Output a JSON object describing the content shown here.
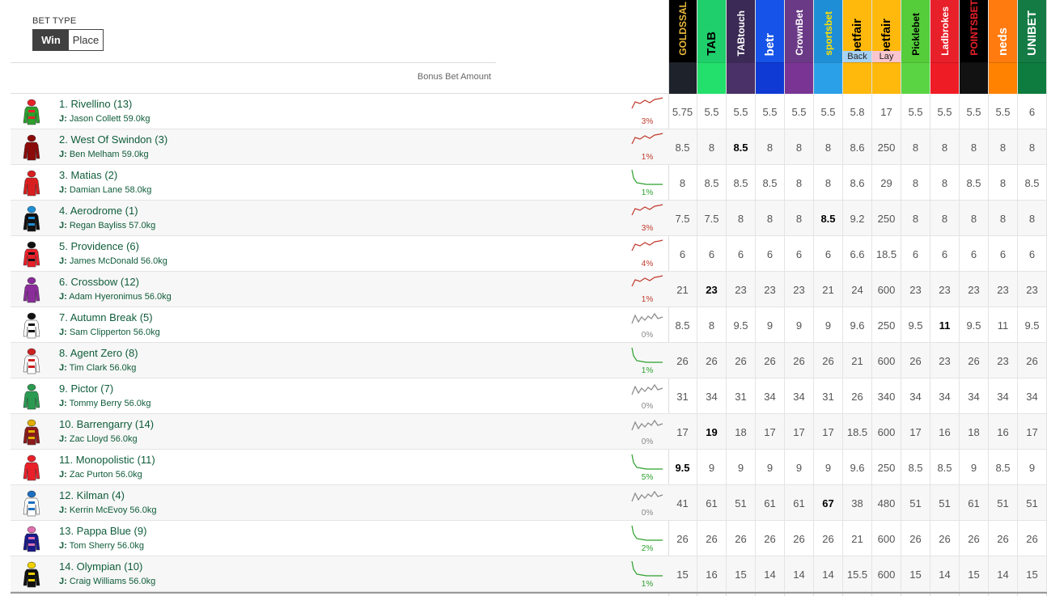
{
  "bet_type": {
    "label": "BET TYPE",
    "win": "Win",
    "place": "Place",
    "selected": "Win"
  },
  "bonus_label": "Bonus Bet Amount",
  "bookmakers": [
    {
      "name": "GOLDSSAL",
      "bg": "#000000",
      "strip": "#1e232b",
      "fg": "#e7b83a"
    },
    {
      "name": "TAB",
      "bg": "#1fcf6b",
      "strip": "#22e06b",
      "fg": "#000000"
    },
    {
      "name": "TABtouch",
      "bg": "#3b2a55",
      "strip": "#4a3167",
      "fg": "#ffffff"
    },
    {
      "name": "betr",
      "bg": "#1653e8",
      "strip": "#0f3bd4",
      "fg": "#ffffff"
    },
    {
      "name": "CrownBet",
      "bg": "#6b3a86",
      "strip": "#7a3594",
      "fg": "#ffffff"
    },
    {
      "name": "sportsbet",
      "bg": "#1e8fd6",
      "strip": "#2aa0e8",
      "fg": "#ffe000"
    },
    {
      "name": "betfair",
      "bg": "#ffb80c",
      "strip": "#ffb80c",
      "fg": "#000000",
      "tag": "Back",
      "tag_bg": "#a6d2f5"
    },
    {
      "name": "betfair",
      "bg": "#ffb80c",
      "strip": "#ffb80c",
      "fg": "#000000",
      "tag": "Lay",
      "tag_bg": "#f9c5cf"
    },
    {
      "name": "Picklebet",
      "bg": "#55cc3a",
      "strip": "#5ad442",
      "fg": "#000000"
    },
    {
      "name": "Ladbrokes",
      "bg": "#e8202a",
      "strip": "#ee1c25",
      "fg": "#ffffff"
    },
    {
      "name": "POINTSBET",
      "bg": "#000000",
      "strip": "#121212",
      "fg": "#e8202a"
    },
    {
      "name": "neds",
      "bg": "#ff7a0f",
      "strip": "#ff8200",
      "fg": "#ffffff"
    },
    {
      "name": "UNIBET",
      "bg": "#147b45",
      "strip": "#0d7c3e",
      "fg": "#ffffff"
    }
  ],
  "runners": [
    {
      "name": "1. Rivellino (13)",
      "jockey": "Jason Collett 59.0kg",
      "silk": [
        "#2ca02c",
        "#e8202a"
      ],
      "trend": "up",
      "pct": "3%",
      "odds": [
        "5.75",
        "5.5",
        "5.5",
        "5.5",
        "5.5",
        "5.5",
        "5.8",
        "17",
        "5.5",
        "5.5",
        "5.5",
        "5.5",
        "6"
      ],
      "best": []
    },
    {
      "name": "2. West Of Swindon (3)",
      "jockey": "Ben Melham 59.0kg",
      "silk": [
        "#8b0a0a",
        "#8b0a0a"
      ],
      "trend": "up",
      "pct": "1%",
      "odds": [
        "8.5",
        "8",
        "8.5",
        "8",
        "8",
        "8",
        "8.6",
        "250",
        "8",
        "8",
        "8",
        "8",
        "8"
      ],
      "best": [
        2
      ]
    },
    {
      "name": "3. Matias (2)",
      "jockey": "Damian Lane 58.0kg",
      "silk": [
        "#d81f1f",
        "#d81f1f"
      ],
      "trend": "down",
      "pct": "1%",
      "odds": [
        "8",
        "8.5",
        "8.5",
        "8.5",
        "8",
        "8",
        "8.6",
        "29",
        "8",
        "8",
        "8.5",
        "8",
        "8.5"
      ],
      "best": []
    },
    {
      "name": "4. Aerodrome (1)",
      "jockey": "Regan Bayliss 57.0kg",
      "silk": [
        "#111111",
        "#1e8fd6"
      ],
      "trend": "up",
      "pct": "3%",
      "odds": [
        "7.5",
        "7.5",
        "8",
        "8",
        "8",
        "8.5",
        "9.2",
        "250",
        "8",
        "8",
        "8",
        "8",
        "8"
      ],
      "best": [
        5
      ]
    },
    {
      "name": "5. Providence (6)",
      "jockey": "James McDonald 56.0kg",
      "silk": [
        "#e8202a",
        "#111111"
      ],
      "trend": "up",
      "pct": "4%",
      "odds": [
        "6",
        "6",
        "6",
        "6",
        "6",
        "6",
        "6.6",
        "18.5",
        "6",
        "6",
        "6",
        "6",
        "6"
      ],
      "best": []
    },
    {
      "name": "6. Crossbow (12)",
      "jockey": "Adam Hyeronimus 56.0kg",
      "silk": [
        "#8a2d9a",
        "#8a2d9a"
      ],
      "trend": "up",
      "pct": "1%",
      "odds": [
        "21",
        "23",
        "23",
        "23",
        "23",
        "21",
        "24",
        "600",
        "23",
        "23",
        "23",
        "23",
        "23"
      ],
      "best": [
        1
      ]
    },
    {
      "name": "7. Autumn Break (5)",
      "jockey": "Sam Clipperton 56.0kg",
      "silk": [
        "#ffffff",
        "#111111"
      ],
      "trend": "flat",
      "pct": "0%",
      "odds": [
        "8.5",
        "8",
        "9.5",
        "9",
        "9",
        "9",
        "9.6",
        "250",
        "9.5",
        "11",
        "9.5",
        "11",
        "9.5"
      ],
      "best": [
        9
      ]
    },
    {
      "name": "8. Agent Zero (8)",
      "jockey": "Tim Clark 56.0kg",
      "silk": [
        "#ffffff",
        "#cc2222"
      ],
      "trend": "down",
      "pct": "1%",
      "odds": [
        "26",
        "26",
        "26",
        "26",
        "26",
        "26",
        "21",
        "600",
        "26",
        "23",
        "26",
        "23",
        "26"
      ],
      "best": []
    },
    {
      "name": "9. Pictor (7)",
      "jockey": "Tommy Berry 56.0kg",
      "silk": [
        "#2a9a50",
        "#2a9a50"
      ],
      "trend": "flat",
      "pct": "0%",
      "odds": [
        "31",
        "34",
        "31",
        "34",
        "34",
        "31",
        "26",
        "340",
        "34",
        "34",
        "34",
        "34",
        "34"
      ],
      "best": []
    },
    {
      "name": "10. Barrengarry (14)",
      "jockey": "Zac Lloyd 56.0kg",
      "silk": [
        "#8b1a1a",
        "#e0b000"
      ],
      "trend": "flat",
      "pct": "0%",
      "odds": [
        "17",
        "19",
        "18",
        "17",
        "17",
        "17",
        "18.5",
        "600",
        "17",
        "16",
        "18",
        "16",
        "17"
      ],
      "best": [
        1
      ]
    },
    {
      "name": "11. Monopolistic (11)",
      "jockey": "Zac Purton 56.0kg",
      "silk": [
        "#e8202a",
        "#e8202a"
      ],
      "trend": "down",
      "pct": "5%",
      "odds": [
        "9.5",
        "9",
        "9",
        "9",
        "9",
        "9",
        "9.6",
        "250",
        "8.5",
        "8.5",
        "9",
        "8.5",
        "9"
      ],
      "best": [
        0
      ]
    },
    {
      "name": "12. Kilman (4)",
      "jockey": "Kerrin McEvoy 56.0kg",
      "silk": [
        "#ffffff",
        "#1e6fc0"
      ],
      "trend": "flat",
      "pct": "0%",
      "odds": [
        "41",
        "61",
        "51",
        "61",
        "61",
        "67",
        "38",
        "480",
        "51",
        "51",
        "61",
        "51",
        "51"
      ],
      "best": [
        5
      ]
    },
    {
      "name": "13. Pappa Blue (9)",
      "jockey": "Tom Sherry 56.0kg",
      "silk": [
        "#1a1a8a",
        "#e070b0"
      ],
      "trend": "down",
      "pct": "2%",
      "odds": [
        "26",
        "26",
        "26",
        "26",
        "26",
        "26",
        "21",
        "600",
        "26",
        "26",
        "26",
        "26",
        "26"
      ],
      "best": []
    },
    {
      "name": "14. Olympian (10)",
      "jockey": "Craig Williams 56.0kg",
      "silk": [
        "#111111",
        "#f0d000"
      ],
      "trend": "down",
      "pct": "1%",
      "odds": [
        "15",
        "16",
        "15",
        "14",
        "14",
        "14",
        "15.5",
        "600",
        "15",
        "14",
        "15",
        "14",
        "15"
      ],
      "best": []
    }
  ]
}
